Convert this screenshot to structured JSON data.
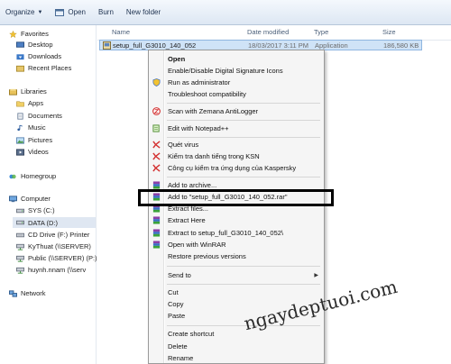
{
  "toolbar": {
    "organize_label": "Organize",
    "open_label": "Open",
    "burn_label": "Burn",
    "new_folder_label": "New folder"
  },
  "columns": {
    "name": "Name",
    "date_modified": "Date modified",
    "type": "Type",
    "size": "Size"
  },
  "sidebar": {
    "favorites": {
      "label": "Favorites",
      "items": [
        "Desktop",
        "Downloads",
        "Recent Places"
      ]
    },
    "libraries": {
      "label": "Libraries",
      "items": [
        "Apps",
        "Documents",
        "Music",
        "Pictures",
        "Videos"
      ]
    },
    "homegroup": "Homegroup",
    "computer": {
      "label": "Computer",
      "items": [
        "SYS (C:)",
        "DATA (D:)",
        "CD Drive (F:) Printer",
        "KyThuat (\\\\SERVER)",
        "Public (\\\\SERVER) (P:)",
        "huynh.nnam (\\\\serv"
      ]
    },
    "network": "Network"
  },
  "file": {
    "name": "setup_full_G3010_140_052",
    "date": "18/03/2017 3:11 PM",
    "type": "Application",
    "size": "186,580 KB"
  },
  "context_menu": {
    "items": [
      "Open",
      "Enable/Disable Digital Signature Icons",
      "Run as administrator",
      "Troubleshoot compatibility",
      "Scan with Zemana AntiLogger",
      "Edit with Notepad++",
      "Quét virus",
      "Kiểm tra danh tiếng trong KSN",
      "Công cụ kiểm tra ứng dụng của Kaspersky",
      "Add to archive...",
      "Add to \"setup_full_G3010_140_052.rar\"",
      "Extract files...",
      "Extract Here",
      "Extract to setup_full_G3010_140_052\\",
      "Open with WinRAR",
      "Restore previous versions",
      "Send to",
      "Cut",
      "Copy",
      "Paste",
      "Create shortcut",
      "Delete",
      "Rename"
    ]
  },
  "watermark": "ngaydeptuoi.com",
  "colors": {
    "selection": "#cfe3f7",
    "menu_bg": "#f5f5f5",
    "toolbar_bg": "#dde7f3",
    "highlight_box": "#000000"
  }
}
